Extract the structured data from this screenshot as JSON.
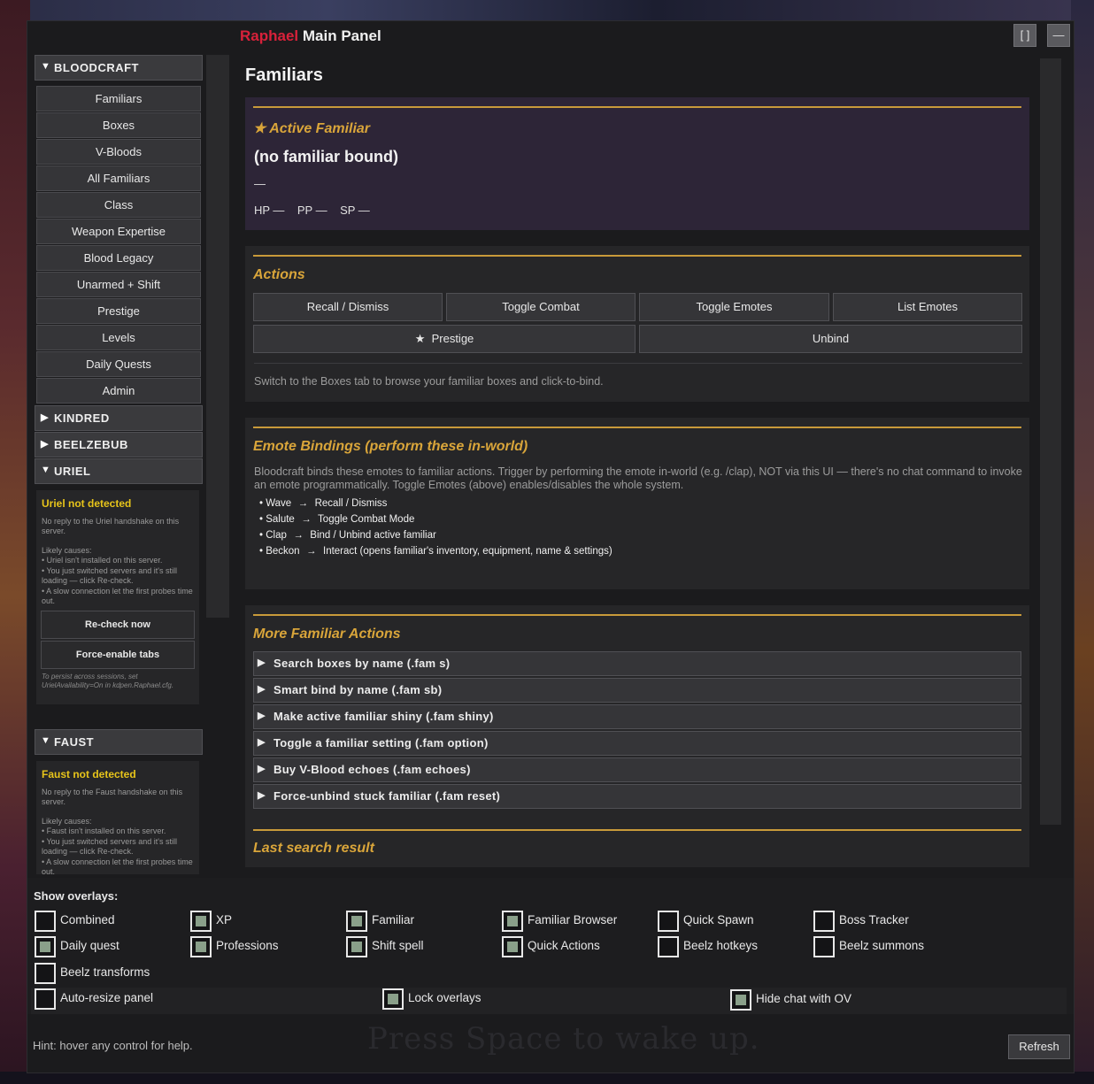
{
  "window": {
    "title_brand": "Raphael",
    "title_rest": "Main Panel",
    "maximize_icon": "[ ]",
    "minimize_icon": "—"
  },
  "sidebar": {
    "bloodcraft": {
      "label": "BLOODCRAFT",
      "expanded_icon": "▼",
      "items": [
        "Familiars",
        "Boxes",
        "V-Bloods",
        "All Familiars",
        "Class",
        "Weapon Expertise",
        "Blood Legacy",
        "Unarmed + Shift",
        "Prestige",
        "Levels",
        "Daily Quests",
        "Admin"
      ]
    },
    "kindred": {
      "label": "KINDRED",
      "icon": "▶"
    },
    "beelzebub": {
      "label": "BEELZEBUB",
      "icon": "▶"
    },
    "uriel": {
      "label": "URIEL",
      "icon": "▼",
      "status_title": "Uriel not detected",
      "status_line1": "No reply to the Uriel handshake on this server.",
      "causes_title": "Likely causes:",
      "cause1": "• Uriel isn't installed on this server.",
      "cause2": "• You just switched servers and it's still loading — click Re-check.",
      "cause3": "• A slow connection let the first probes time out.",
      "recheck_label": "Re-check now",
      "force_label": "Force-enable tabs",
      "note": "To persist across sessions, set UrielAvailability=On in kdpen.Raphael.cfg."
    },
    "faust": {
      "label": "FAUST",
      "icon": "▼",
      "status_title": "Faust not detected",
      "status_line1": "No reply to the Faust handshake on this server.",
      "causes_title": "Likely causes:",
      "cause1": "• Faust isn't installed on this server.",
      "cause2": "• You just switched servers and it's still loading — click Re-check.",
      "cause3": "• A slow connection let the first probes time out."
    }
  },
  "main": {
    "page_title": "Familiars",
    "active": {
      "star": "★",
      "heading": "Active Familiar",
      "name": "(no familiar bound)",
      "subline": "—",
      "hp": "HP —",
      "pp": "PP —",
      "sp": "SP —"
    },
    "actions": {
      "heading": "Actions",
      "recall": "Recall / Dismiss",
      "toggle_combat": "Toggle Combat",
      "toggle_emotes": "Toggle Emotes",
      "list_emotes": "List Emotes",
      "prestige_star": "★",
      "prestige": "Prestige",
      "unbind": "Unbind",
      "hint": "Switch to the Boxes tab to browse your familiar boxes and click-to-bind."
    },
    "emotes": {
      "heading": "Emote Bindings (perform these in-world)",
      "description": "Bloodcraft binds these emotes to familiar actions. Trigger by performing the emote in-world (e.g. /clap), NOT via this UI — there's no chat command to invoke an emote programmatically. Toggle Emotes (above) enables/disables the whole system.",
      "arrow": "→",
      "bindings": [
        {
          "emote": "• Wave",
          "action": "Recall / Dismiss"
        },
        {
          "emote": "• Salute",
          "action": "Toggle Combat Mode"
        },
        {
          "emote": "• Clap",
          "action": "Bind / Unbind active familiar"
        },
        {
          "emote": "• Beckon",
          "action": "Interact (opens familiar's inventory, equipment, name & settings)"
        }
      ]
    },
    "more": {
      "heading": "More Familiar Actions",
      "items": [
        "Search boxes by name (.fam s)",
        "Smart bind by name (.fam sb)",
        "Make active familiar shiny (.fam shiny)",
        "Toggle a familiar setting (.fam option)",
        "Buy V-Blood echoes (.fam echoes)",
        "Force-unbind stuck familiar (.fam reset)"
      ]
    },
    "last_search": {
      "heading": "Last search result"
    }
  },
  "overlays": {
    "title": "Show overlays:",
    "items": [
      {
        "label": "Combined",
        "checked": false
      },
      {
        "label": "XP",
        "checked": true
      },
      {
        "label": "Familiar",
        "checked": true
      },
      {
        "label": "Familiar Browser",
        "checked": true
      },
      {
        "label": "Quick Spawn",
        "checked": false
      },
      {
        "label": "Boss Tracker",
        "checked": false
      },
      {
        "label": "Daily quest",
        "checked": true
      },
      {
        "label": "Professions",
        "checked": true
      },
      {
        "label": "Shift spell",
        "checked": true
      },
      {
        "label": "Quick Actions",
        "checked": true
      },
      {
        "label": "Beelz hotkeys",
        "checked": false
      },
      {
        "label": "Beelz summons",
        "checked": false
      },
      {
        "label": "Beelz transforms",
        "checked": false
      }
    ],
    "options": [
      {
        "label": "Auto-resize panel",
        "checked": false
      },
      {
        "label": "Lock overlays",
        "checked": true
      },
      {
        "label": "Hide chat with OV",
        "checked": true
      }
    ]
  },
  "footer": {
    "hint": "Hint: hover any control for help.",
    "refresh": "Refresh",
    "background_text": "Press Space to wake up."
  },
  "colors": {
    "brand": "#d9213a",
    "accent_gold": "#d9a53a",
    "warning": "#e7c41a",
    "checkbox_fill": "#8aa08a"
  }
}
